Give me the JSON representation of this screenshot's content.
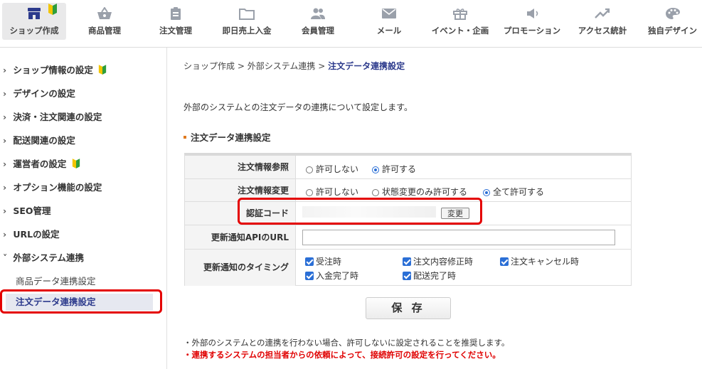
{
  "nav": {
    "items": [
      {
        "label": "ショップ作成",
        "icon": "shop-icon"
      },
      {
        "label": "商品管理",
        "icon": "basket-icon"
      },
      {
        "label": "注文管理",
        "icon": "clipboard-icon"
      },
      {
        "label": "即日売上入金",
        "icon": "folder-icon"
      },
      {
        "label": "会員管理",
        "icon": "members-icon"
      },
      {
        "label": "メール",
        "icon": "mail-icon"
      },
      {
        "label": "イベント・企画",
        "icon": "gift-icon"
      },
      {
        "label": "プロモーション",
        "icon": "megaphone-icon"
      },
      {
        "label": "アクセス統計",
        "icon": "trend-icon"
      },
      {
        "label": "独自デザイン",
        "icon": "palette-icon"
      }
    ]
  },
  "sidebar": {
    "items": [
      {
        "label": "ショップ情報の設定"
      },
      {
        "label": "デザインの設定"
      },
      {
        "label": "決済・注文関連の設定"
      },
      {
        "label": "配送関連の設定"
      },
      {
        "label": "運営者の設定"
      },
      {
        "label": "オプション機能の設定"
      },
      {
        "label": "SEO管理"
      },
      {
        "label": "URLの設定"
      },
      {
        "label": "外部システム連携"
      }
    ],
    "subitems": [
      {
        "label": "商品データ連携設定"
      },
      {
        "label": "注文データ連携設定"
      }
    ]
  },
  "breadcrumb": {
    "part1": "ショップ作成",
    "part2": "外部システム連携",
    "current": "注文データ連携設定",
    "sep": ">"
  },
  "intro": "外部のシステムとの注文データの連携について設定します。",
  "section_title": "注文データ連携設定",
  "form": {
    "order_ref": {
      "label": "注文情報参照",
      "options": [
        "許可しない",
        "許可する"
      ],
      "selected": "許可する"
    },
    "order_change": {
      "label": "注文情報変更",
      "options": [
        "許可しない",
        "状態変更のみ許可する",
        "全て許可する"
      ],
      "selected": "全て許可する"
    },
    "auth_code": {
      "label": "認証コード",
      "button": "変更"
    },
    "api_url": {
      "label": "更新通知APIのURL",
      "value": ""
    },
    "timing": {
      "label": "更新通知のタイミング",
      "options": [
        "受注時",
        "注文内容修正時",
        "注文キャンセル時",
        "入金完了時",
        "配送完了時"
      ]
    }
  },
  "save_label": "保 存",
  "notes": {
    "note1": "・外部のシステムとの連携を行わない場合、許可しないに設定されることを推奨します。",
    "note2": "・連携するシステムの担当者からの依頼によって、接続許可の設定を行ってください。"
  },
  "colors": {
    "accent": "#2c3a8c",
    "highlight": "#e40000",
    "checkbox": "#2b6fd6",
    "note_red": "#e00000"
  }
}
